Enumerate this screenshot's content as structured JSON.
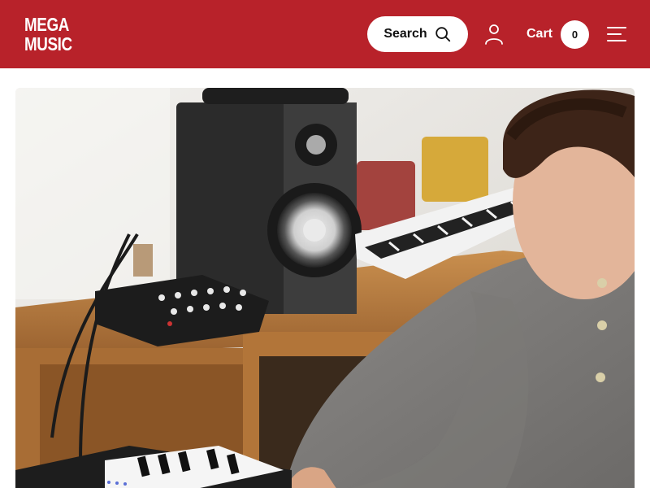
{
  "header": {
    "logo": {
      "line1": "MEGA",
      "line2": "MUSIC"
    },
    "search_label": "Search",
    "cart_label": "Cart",
    "cart_count": "0",
    "icons": {
      "search": "search-icon",
      "account": "user-icon",
      "menu": "menu-icon"
    }
  },
  "colors": {
    "brand": "#b8222a",
    "header_text": "#ffffff"
  },
  "hero": {
    "image": "hero-image"
  }
}
